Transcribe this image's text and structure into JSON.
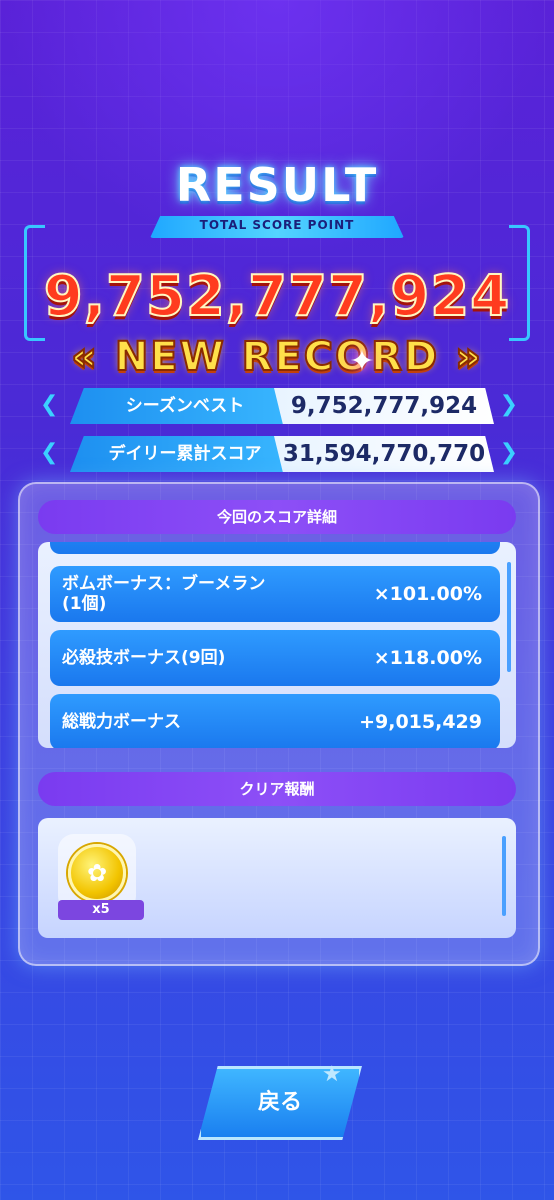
{
  "header": {
    "title": "RESULT",
    "subtitle": "TOTAL SCORE POINT",
    "total_score": "9,752,777,924",
    "new_record": "« NEW RECORD »"
  },
  "stats": [
    {
      "label": "シーズンベスト",
      "value": "9,752,777,924"
    },
    {
      "label": "デイリー累計スコア",
      "value": "31,594,770,770"
    }
  ],
  "score_detail": {
    "heading": "今回のスコア詳細",
    "items": [
      {
        "name_line1": "ボムボーナス：ブーメラン",
        "name_line2": "(1個)",
        "value": "×101.00%"
      },
      {
        "name_line1": "必殺技ボーナス(9回)",
        "name_line2": "",
        "value": "×118.00%"
      },
      {
        "name_line1": "総戦力ボーナス",
        "name_line2": "",
        "value": "+9,015,429"
      }
    ]
  },
  "clear_reward": {
    "heading": "クリア報酬",
    "items": [
      {
        "icon": "coin-icon",
        "count": "x5"
      }
    ]
  },
  "back_button": {
    "label": "戻る"
  },
  "colors": {
    "accent_cyan": "#38c7ff",
    "score_red": "#ff3b1e",
    "record_yellow": "#ffe04a",
    "section_purple": "#7a3bf0",
    "item_blue": "#1a78ee"
  }
}
